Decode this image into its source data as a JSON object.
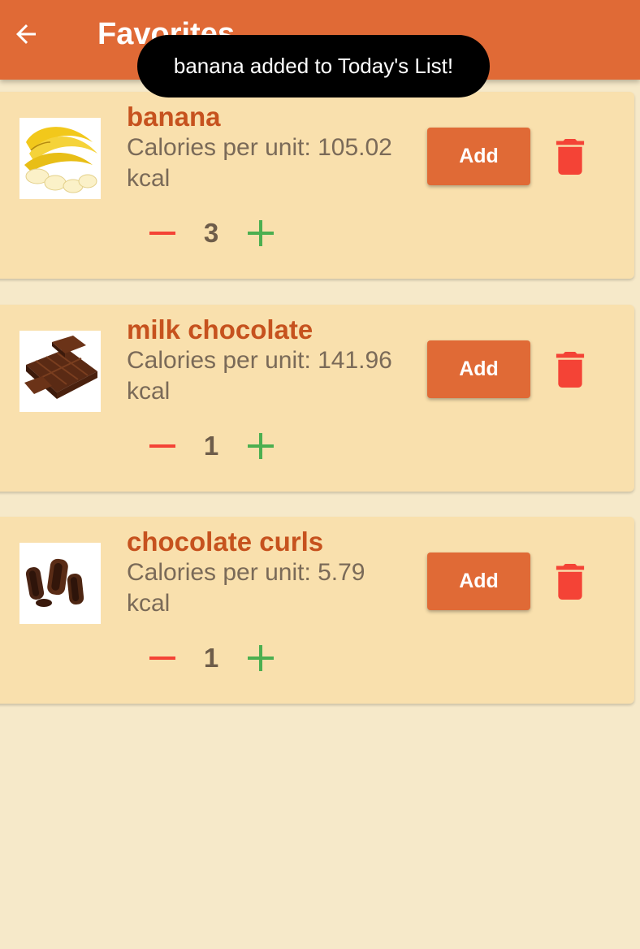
{
  "appbar": {
    "title": "Favorites",
    "back_icon": "arrow-left-icon",
    "background": "#e06a36"
  },
  "toast": {
    "message": "banana added to Today's List!"
  },
  "items": [
    {
      "name": "banana",
      "calories": "Calories per unit: 105.02 kcal",
      "quantity": "3",
      "add_label": "Add",
      "image_icon": "banana-image"
    },
    {
      "name": "milk chocolate",
      "calories": "Calories per unit: 141.96 kcal",
      "quantity": "1",
      "add_label": "Add",
      "image_icon": "milk-chocolate-image"
    },
    {
      "name": "chocolate curls",
      "calories": "Calories per unit: 5.79 kcal",
      "quantity": "1",
      "add_label": "Add",
      "image_icon": "chocolate-curls-image"
    }
  ],
  "colors": {
    "accent": "#e06a36",
    "card": "#f9e0ad",
    "background": "#f6e9c9",
    "name_text": "#c6521e",
    "delete": "#f44336",
    "minus": "#f44336",
    "plus": "#4caf50"
  }
}
